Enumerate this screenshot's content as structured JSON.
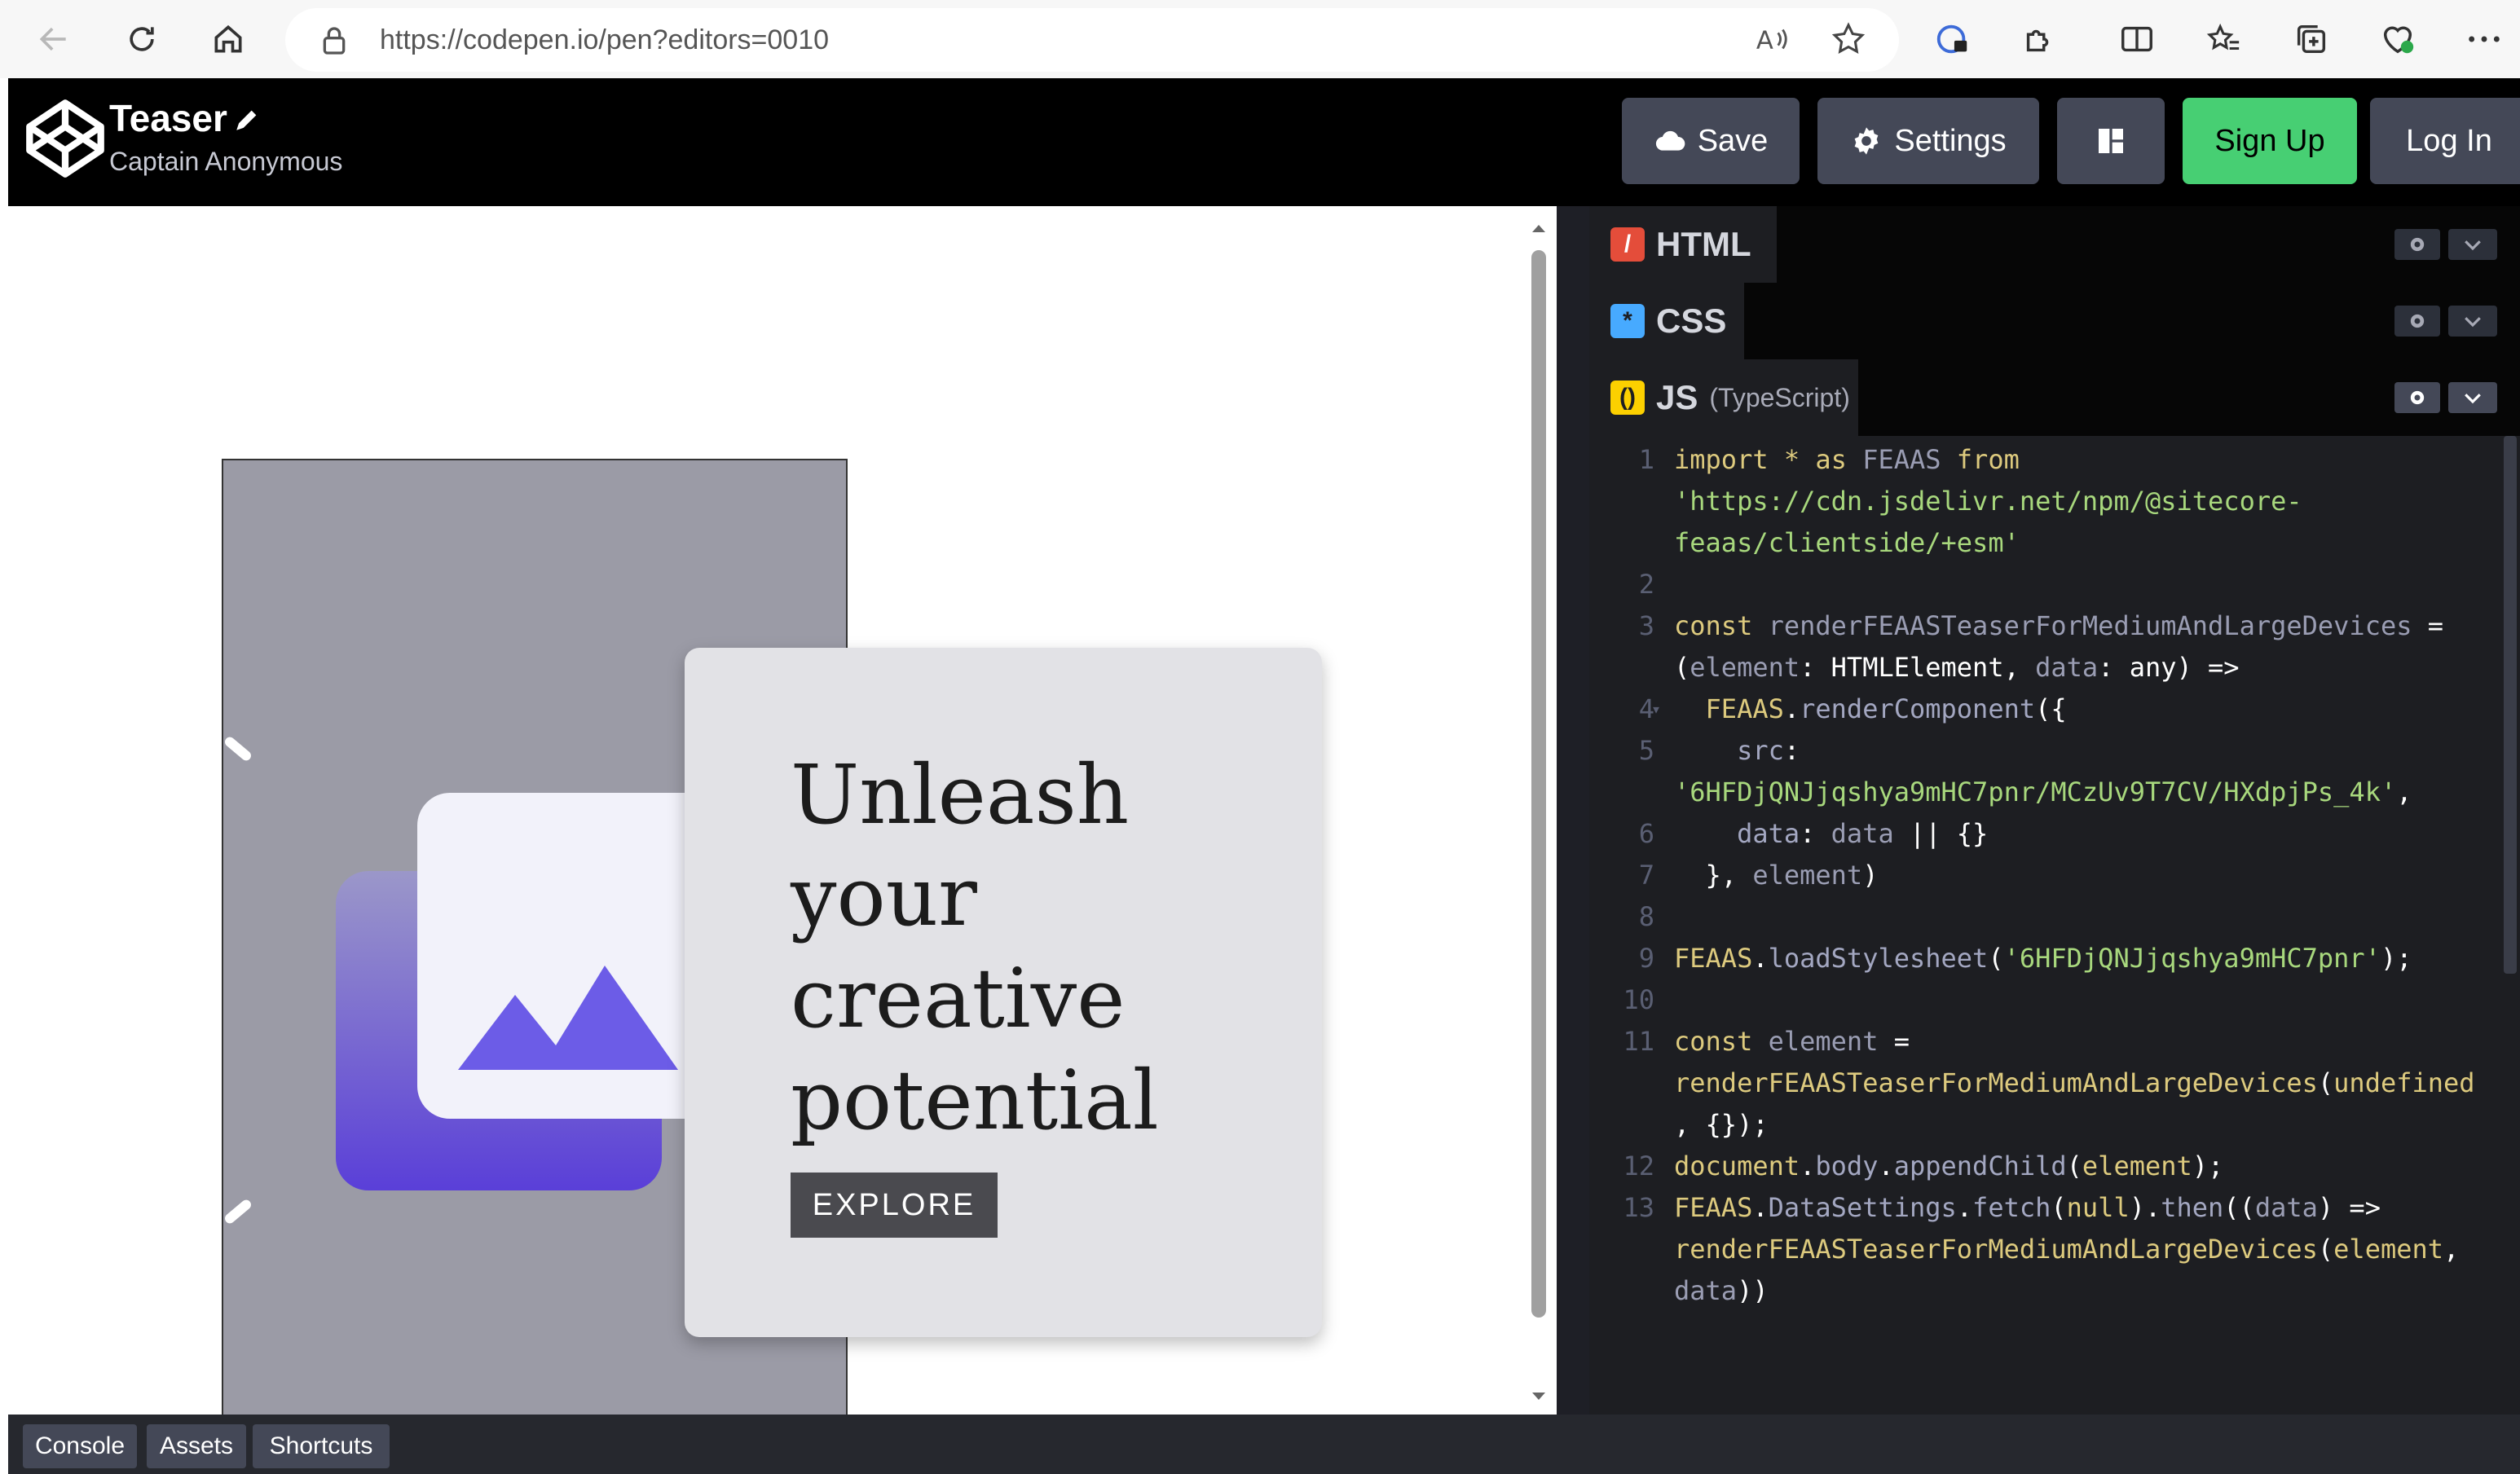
{
  "browser": {
    "url": "https://codepen.io/pen?editors=0010"
  },
  "header": {
    "pen_title": "Teaser",
    "author": "Captain Anonymous",
    "save_label": "Save",
    "settings_label": "Settings",
    "signup_label": "Sign Up",
    "login_label": "Log In"
  },
  "preview": {
    "heading_lines": [
      "Unleash",
      "your",
      "creative",
      "potential"
    ],
    "explore_label": "EXPLORE"
  },
  "editors": {
    "html_label": "HTML",
    "css_label": "CSS",
    "js_label": "JS",
    "js_sub": "(TypeScript)"
  },
  "code": {
    "line_numbers": [
      "1",
      "2",
      "3",
      "4",
      "5",
      "6",
      "7",
      "8",
      "9",
      "10",
      "11",
      "12",
      "13"
    ]
  },
  "bottom": {
    "console_label": "Console",
    "assets_label": "Assets",
    "shortcuts_label": "Shortcuts"
  },
  "colors": {
    "header_bg": "#000000",
    "signup_green": "#47cf73",
    "html_icon": "#e44d3a",
    "css_icon": "#47aaff",
    "js_icon": "#fcd000",
    "image_purple": "#6c5ce7"
  }
}
